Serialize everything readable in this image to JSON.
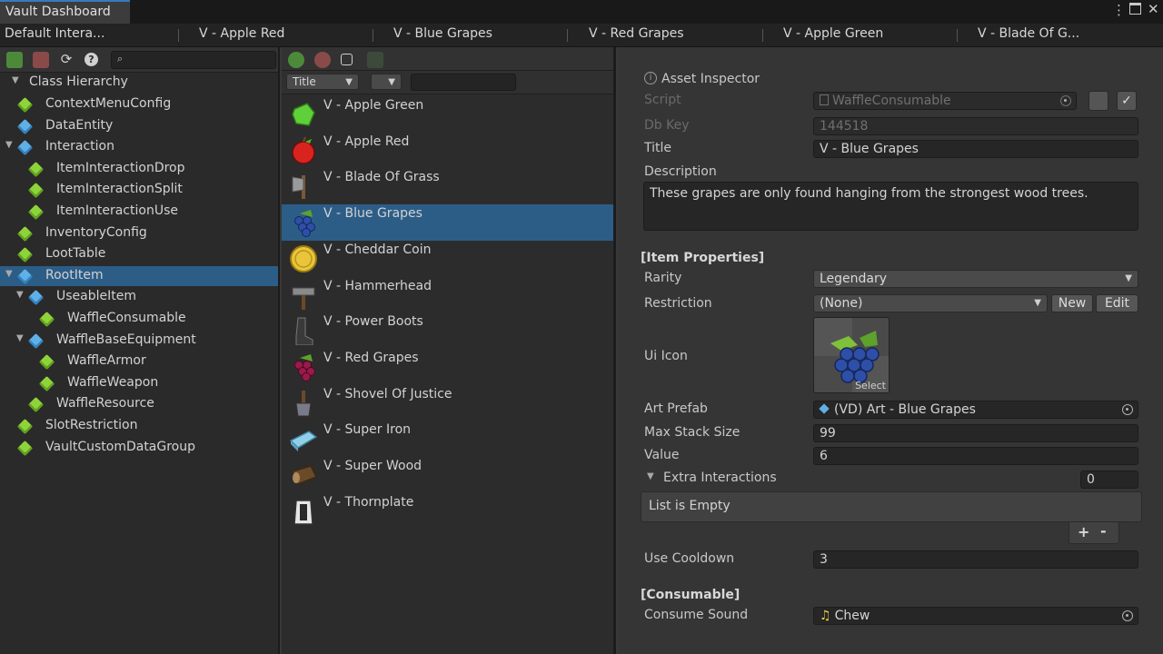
{
  "window": {
    "title": "Vault Dashboard",
    "menu_icon": "kebab-menu-icon",
    "maximize_icon": "maximize-icon",
    "close_icon": "close-icon"
  },
  "tabs": [
    "Default Intera...",
    "V - Apple Red",
    "V - Blue Grapes",
    "V - Red Grapes",
    "V - Apple Green",
    "V - Blade Of G..."
  ],
  "hierarchy": {
    "toolbar_icons": [
      "add-item-icon",
      "delete-item-icon",
      "refresh-icon",
      "help-icon"
    ],
    "search_value": "",
    "root_label": "Class Hierarchy",
    "items": [
      {
        "label": "ContextMenuConfig",
        "color": "green"
      },
      {
        "label": "DataEntity",
        "color": "blue"
      },
      {
        "label": "Interaction",
        "color": "blue"
      },
      {
        "label": "ItemInteractionDrop",
        "color": "green"
      },
      {
        "label": "ItemInteractionSplit",
        "color": "green"
      },
      {
        "label": "ItemInteractionUse",
        "color": "green"
      },
      {
        "label": "InventoryConfig",
        "color": "green"
      },
      {
        "label": "LootTable",
        "color": "green"
      },
      {
        "label": "RootItem",
        "color": "blue"
      },
      {
        "label": "UseableItem",
        "color": "blue"
      },
      {
        "label": "WaffleConsumable",
        "color": "green"
      },
      {
        "label": "WaffleBaseEquipment",
        "color": "blue"
      },
      {
        "label": "WaffleArmor",
        "color": "green"
      },
      {
        "label": "WaffleWeapon",
        "color": "green"
      },
      {
        "label": "WaffleResource",
        "color": "green"
      },
      {
        "label": "SlotRestriction",
        "color": "green"
      },
      {
        "label": "VaultCustomDataGroup",
        "color": "green"
      }
    ]
  },
  "assets": {
    "toolbar_icons": [
      "new-asset-icon",
      "delete-asset-icon",
      "duplicate-icon",
      "filter-icon"
    ],
    "sort_option": "Title",
    "filter_option": "",
    "search_value": "",
    "items": [
      {
        "label": "V - Apple Green",
        "icon": "apple-green-icon"
      },
      {
        "label": "V - Apple Red",
        "icon": "apple-red-icon"
      },
      {
        "label": "V - Blade Of Grass",
        "icon": "axe-icon"
      },
      {
        "label": "V - Blue Grapes",
        "icon": "grapes-blue-icon"
      },
      {
        "label": "V - Cheddar Coin",
        "icon": "coin-icon"
      },
      {
        "label": "V - Hammerhead",
        "icon": "hammer-icon"
      },
      {
        "label": "V - Power Boots",
        "icon": "boots-icon"
      },
      {
        "label": "V - Red Grapes",
        "icon": "grapes-red-icon"
      },
      {
        "label": "V - Shovel Of Justice",
        "icon": "shovel-icon"
      },
      {
        "label": "V - Super Iron",
        "icon": "iron-bar-icon"
      },
      {
        "label": "V - Super Wood",
        "icon": "wood-log-icon"
      },
      {
        "label": "V - Thornplate",
        "icon": "armor-plate-icon"
      }
    ]
  },
  "inspector": {
    "header": "Asset Inspector",
    "header_icon": "info-icon",
    "script_label": "Script",
    "script_value": "WaffleConsumable",
    "dbkey_label": "Db Key",
    "dbkey_value": "144518",
    "title_label": "Title",
    "title_value": "V - Blue Grapes",
    "description_label": "Description",
    "description_value": "These grapes are only found hanging from the strongest wood trees.",
    "item_properties_header": "[Item Properties]",
    "rarity_label": "Rarity",
    "rarity_value": "Legendary",
    "restriction_label": "Restriction",
    "restriction_value": "(None)",
    "new_button": "New",
    "edit_button": "Edit",
    "ui_icon_label": "Ui Icon",
    "select_label": "Select",
    "art_prefab_label": "Art Prefab",
    "art_prefab_value": "(VD) Art - Blue Grapes",
    "max_stack_label": "Max Stack Size",
    "max_stack_value": "99",
    "value_label": "Value",
    "value_value": "6",
    "extra_interactions_label": "Extra Interactions",
    "extra_interactions_count": "0",
    "list_empty": "List is Empty",
    "add_button": "+",
    "remove_button": "-",
    "use_cooldown_label": "Use Cooldown",
    "use_cooldown_value": "3",
    "consumable_header": "[Consumable]",
    "consume_sound_label": "Consume Sound",
    "consume_sound_value": "Chew"
  },
  "colors": {
    "selection": "#2c5d87",
    "accent": "#3a79bb"
  }
}
